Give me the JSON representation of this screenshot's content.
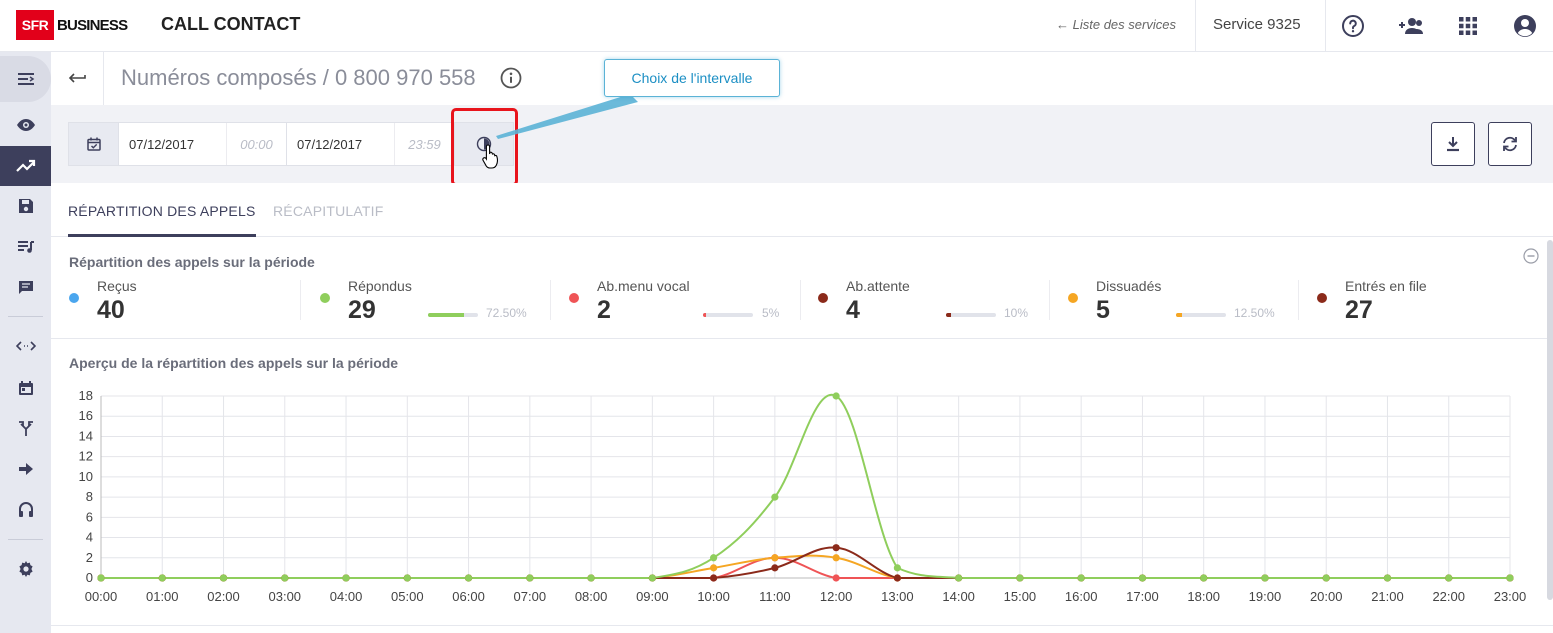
{
  "header": {
    "logo_mark": "SFR",
    "logo_text": "BUSINESS",
    "app_title": "CALL CONTACT",
    "services_link": "Liste des services",
    "service_name": "Service 9325"
  },
  "page": {
    "title": "Numéros composés / 0 800 970 558"
  },
  "filters": {
    "start_date": "07/12/2017",
    "start_time": "00:00",
    "end_date": "07/12/2017",
    "end_time": "23:59"
  },
  "callout": {
    "text": "Choix de l'intervalle"
  },
  "tabs": [
    {
      "label": "RÉPARTITION DES APPELS"
    },
    {
      "label": "RÉCAPITULATIF"
    }
  ],
  "stats": {
    "title": "Répartition des appels sur la période",
    "items": [
      {
        "label": "Reçus",
        "value": "40",
        "color": "#4aa6ee"
      },
      {
        "label": "Répondus",
        "value": "29",
        "percent": "72.50%",
        "fraction": 0.725,
        "color": "#8fce5c"
      },
      {
        "label": "Ab.menu vocal",
        "value": "2",
        "percent": "5%",
        "fraction": 0.05,
        "color": "#ef5456"
      },
      {
        "label": "Ab.attente",
        "value": "4",
        "percent": "10%",
        "fraction": 0.1,
        "color": "#8b2a1a"
      },
      {
        "label": "Dissuadés",
        "value": "5",
        "percent": "12.50%",
        "fraction": 0.125,
        "color": "#f5a623"
      },
      {
        "label": "Entrés en file",
        "value": "27",
        "color": "#8b2a1a"
      }
    ]
  },
  "chart_section": {
    "title": "Aperçu de la répartition des appels sur la période"
  },
  "chart_data": {
    "type": "line",
    "x": [
      "00:00",
      "01:00",
      "02:00",
      "03:00",
      "04:00",
      "05:00",
      "06:00",
      "07:00",
      "08:00",
      "09:00",
      "10:00",
      "11:00",
      "12:00",
      "13:00",
      "14:00",
      "15:00",
      "16:00",
      "17:00",
      "18:00",
      "19:00",
      "20:00",
      "21:00",
      "22:00",
      "23:00"
    ],
    "ylim": [
      0,
      18
    ],
    "yticks": [
      0,
      2,
      4,
      6,
      8,
      10,
      12,
      14,
      16,
      18
    ],
    "grid": true,
    "series": [
      {
        "color": "#ef5456",
        "values": [
          0,
          0,
          0,
          0,
          0,
          0,
          0,
          0,
          0,
          0,
          0,
          2,
          0,
          0,
          0,
          0,
          0,
          0,
          0,
          0,
          0,
          0,
          0,
          0
        ]
      },
      {
        "color": "#f5a623",
        "values": [
          0,
          0,
          0,
          0,
          0,
          0,
          0,
          0,
          0,
          0,
          1,
          2,
          2,
          0,
          0,
          0,
          0,
          0,
          0,
          0,
          0,
          0,
          0,
          0
        ]
      },
      {
        "color": "#8b2a1a",
        "values": [
          0,
          0,
          0,
          0,
          0,
          0,
          0,
          0,
          0,
          0,
          0,
          1,
          3,
          0,
          0,
          0,
          0,
          0,
          0,
          0,
          0,
          0,
          0,
          0
        ]
      },
      {
        "color": "#8fce5c",
        "values": [
          0,
          0,
          0,
          0,
          0,
          0,
          0,
          0,
          0,
          0,
          2,
          8,
          18,
          1,
          0,
          0,
          0,
          0,
          0,
          0,
          0,
          0,
          0,
          0
        ]
      }
    ]
  }
}
